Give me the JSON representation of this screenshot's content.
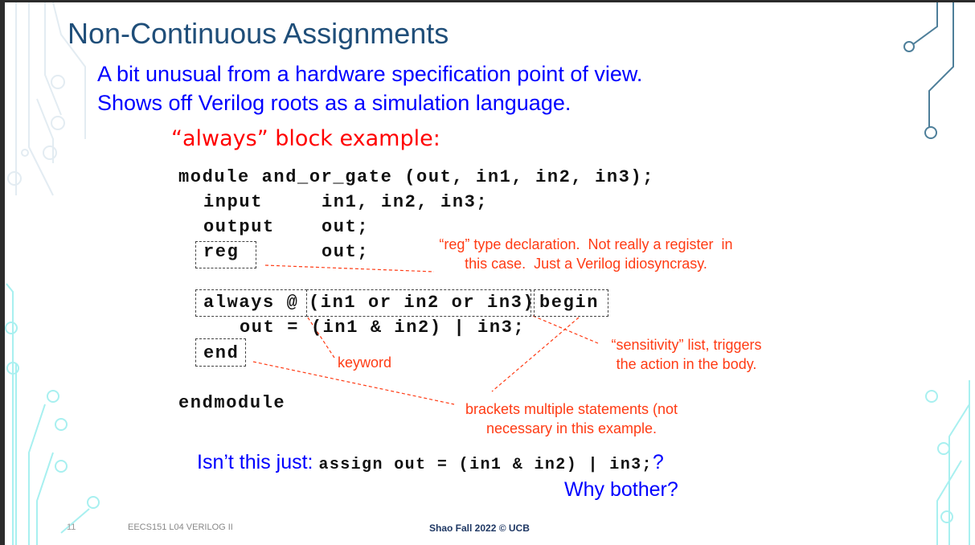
{
  "title": "Non-Continuous Assignments",
  "subtitle_lines": [
    "A bit unusual from a hardware specification point of view.",
    "Shows off Verilog roots as a simulation language."
  ],
  "example_heading": "“always” block example:",
  "code": {
    "module_line": "module and_or_gate (out, in1, in2, in3);",
    "input_kw": "input",
    "input_args": "in1, in2, in3;",
    "output_kw": "output",
    "output_args": "out;",
    "reg_kw": "reg",
    "reg_args": "out;",
    "always_kw": "always @",
    "sensitivity": "(in1 or in2 or in3)",
    "begin_kw": "begin",
    "body": "out = (in1 & in2) | in3;",
    "end_kw": "end",
    "endmodule": "endmodule"
  },
  "annotations": {
    "reg": "“reg” type declaration.  Not really a register  in\nthis case.  Just a Verilog idiosyncrasy.",
    "keyword": "keyword",
    "sensitivity": "“sensitivity” list, triggers\nthe action in the body.",
    "brackets": "brackets multiple statements (not\nnecessary in this example."
  },
  "question": {
    "prefix": "Isn’t this just: ",
    "code": "assign out = (in1 & in2) | in3;",
    "suffix": "?",
    "why": "Why bother?"
  },
  "footer": {
    "page": "11",
    "course": "EECS151 L04 VERILOG II",
    "credit": "Shao Fall 2022 © UCB"
  },
  "colors": {
    "title": "#1f4e79",
    "blue": "#0000ff",
    "red": "#ff0000",
    "annotation": "#ff3b14"
  }
}
